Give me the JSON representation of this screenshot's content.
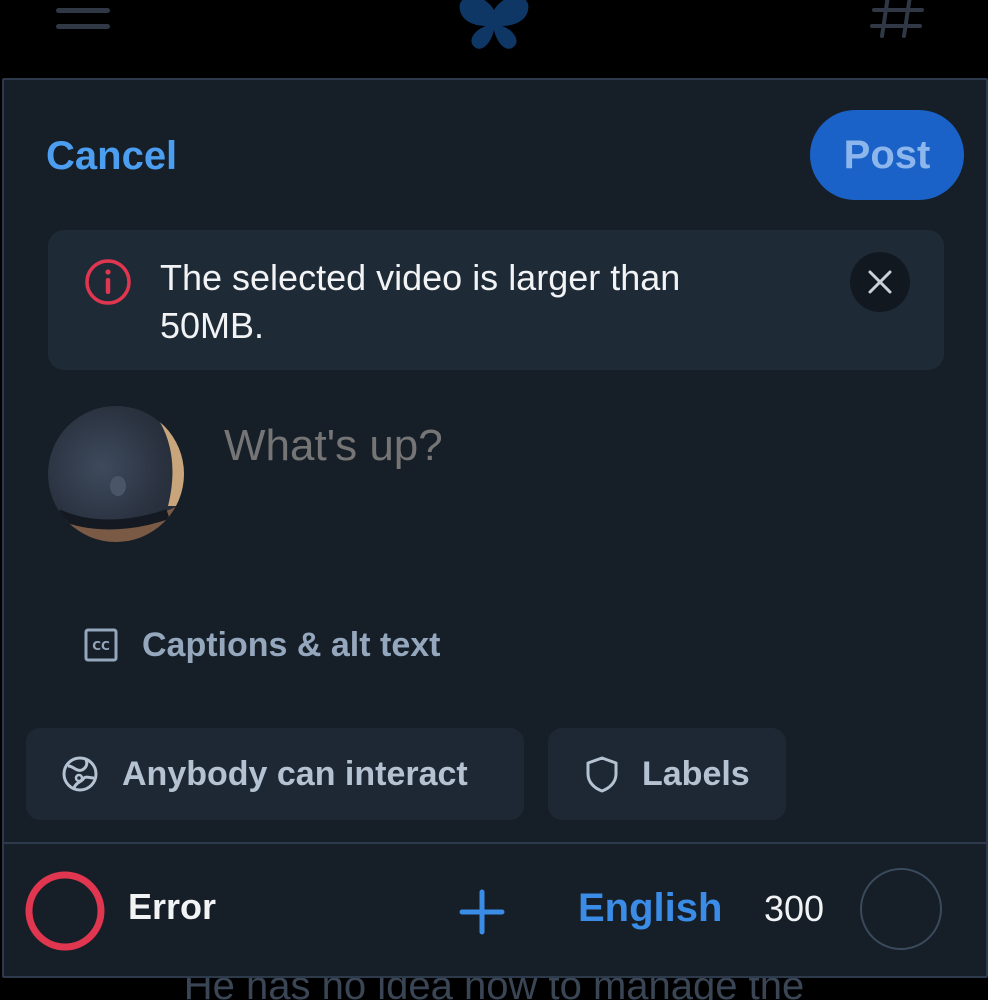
{
  "header": {
    "menu_icon": "hamburger-icon",
    "logo_icon": "butterfly-logo",
    "feeds_icon": "hashtag-icon"
  },
  "composer": {
    "cancel_label": "Cancel",
    "post_label": "Post",
    "error_banner": {
      "message": "The selected video is larger than 50MB.",
      "icon": "info-icon",
      "close_icon": "close-icon"
    },
    "placeholder": "What's up?",
    "captions_label": "Captions & alt text",
    "interaction_label": "Anybody can interact",
    "labels_label": "Labels"
  },
  "footer": {
    "status_label": "Error",
    "add_icon": "plus-icon",
    "language": "English",
    "char_remaining": "300"
  },
  "background_text": "He has no idea how to manage the",
  "colors": {
    "accent": "#1a62c7",
    "link": "#4b9ef0",
    "error": "#e0364f",
    "panel": "#161e27"
  }
}
